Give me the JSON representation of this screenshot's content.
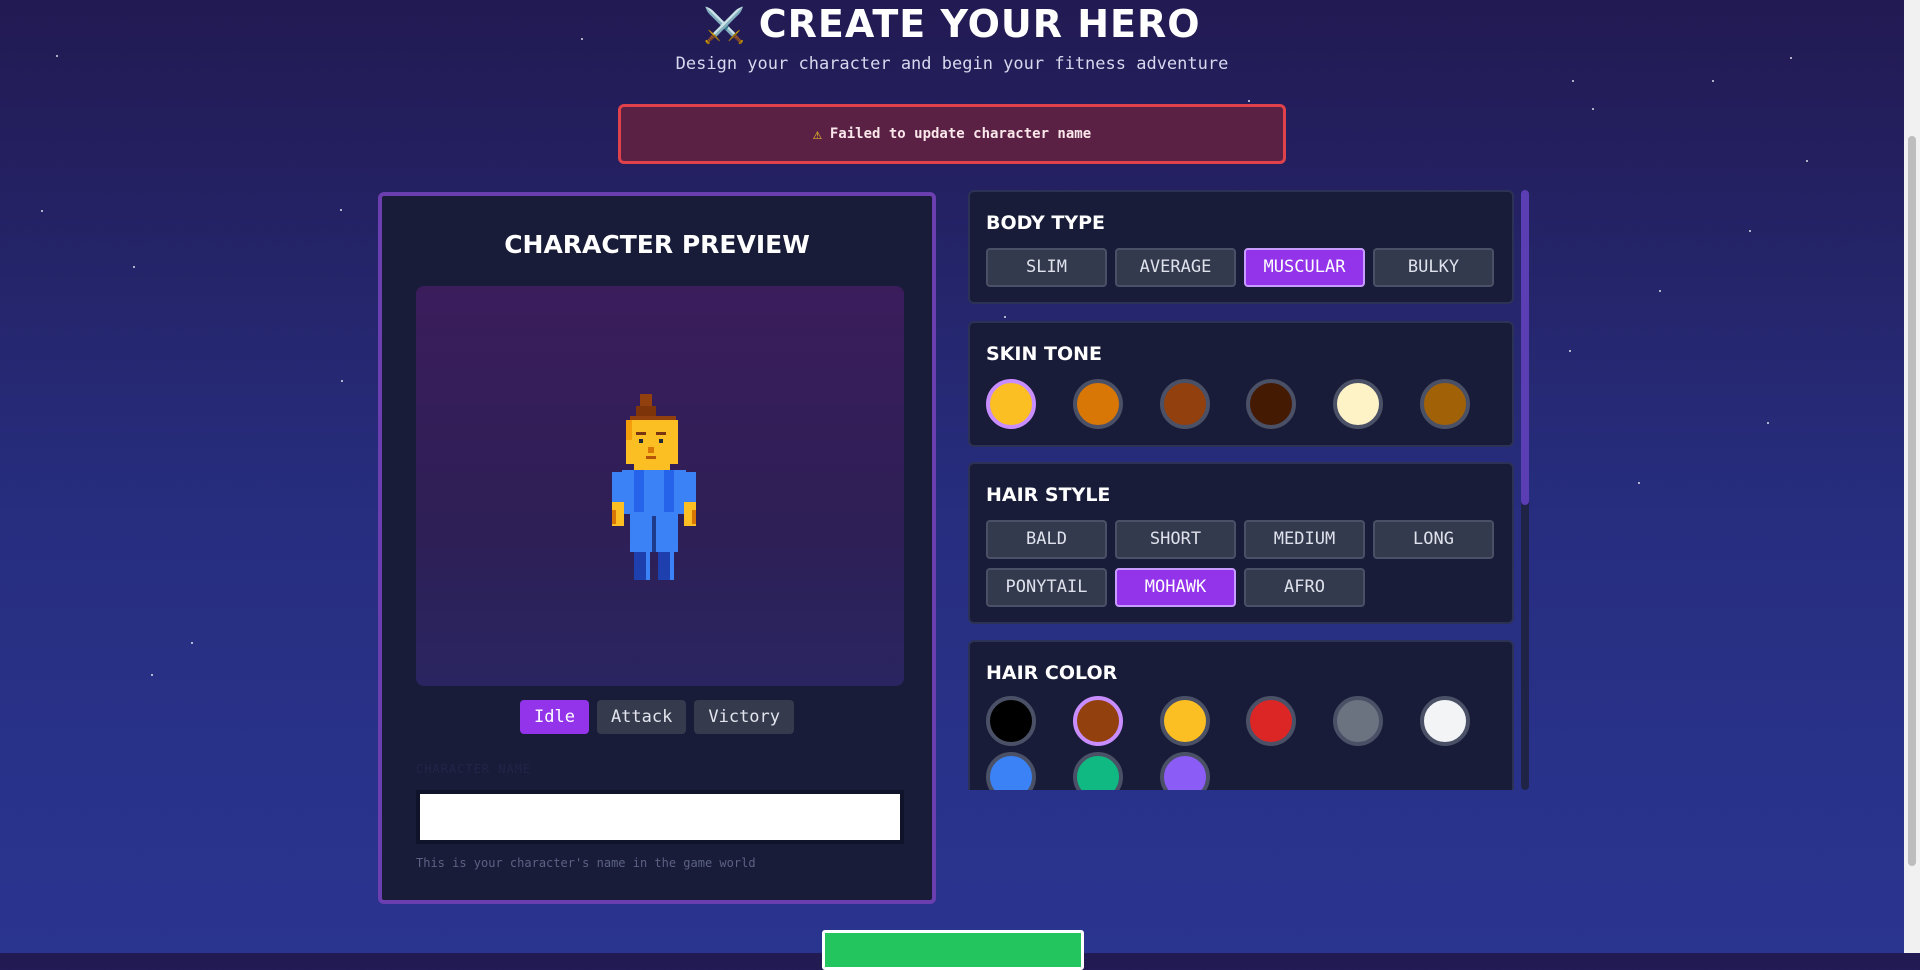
{
  "header": {
    "title": "CREATE YOUR HERO",
    "title_icon": "crossed-swords-icon",
    "subtitle": "Design your character and begin your fitness adventure"
  },
  "alert": {
    "icon": "warning-icon",
    "message": "Failed to update character name",
    "colors": {
      "background": "#5a2145",
      "border": "#e0424b"
    }
  },
  "preview": {
    "title": "CHARACTER PREVIEW",
    "animations": [
      {
        "label": "Idle",
        "selected": true
      },
      {
        "label": "Attack",
        "selected": false
      },
      {
        "label": "Victory",
        "selected": false
      }
    ],
    "name_field": {
      "label": "CHARACTER NAME",
      "value": "",
      "hint": "This is your character's name in the game world"
    }
  },
  "sections": {
    "body_type": {
      "title": "BODY TYPE",
      "options": [
        {
          "label": "SLIM",
          "selected": false
        },
        {
          "label": "AVERAGE",
          "selected": false
        },
        {
          "label": "MUSCULAR",
          "selected": true
        },
        {
          "label": "BULKY",
          "selected": false
        }
      ]
    },
    "skin_tone": {
      "title": "SKIN TONE",
      "swatches": [
        {
          "color": "#fbbf24",
          "selected": true
        },
        {
          "color": "#d97706",
          "selected": false
        },
        {
          "color": "#92400e",
          "selected": false
        },
        {
          "color": "#451a03",
          "selected": false
        },
        {
          "color": "#fef3c7",
          "selected": false
        },
        {
          "color": "#a16207",
          "selected": false
        }
      ]
    },
    "hair_style": {
      "title": "HAIR STYLE",
      "options": [
        {
          "label": "BALD",
          "selected": false
        },
        {
          "label": "SHORT",
          "selected": false
        },
        {
          "label": "MEDIUM",
          "selected": false
        },
        {
          "label": "LONG",
          "selected": false
        },
        {
          "label": "PONYTAIL",
          "selected": false
        },
        {
          "label": "MOHAWK",
          "selected": true
        },
        {
          "label": "AFRO",
          "selected": false
        }
      ]
    },
    "hair_color": {
      "title": "HAIR COLOR",
      "swatches": [
        {
          "color": "#000000",
          "selected": false
        },
        {
          "color": "#92400e",
          "selected": true
        },
        {
          "color": "#fbbf24",
          "selected": false
        },
        {
          "color": "#dc2626",
          "selected": false
        },
        {
          "color": "#6b7280",
          "selected": false
        },
        {
          "color": "#f3f4f6",
          "selected": false
        },
        {
          "color": "#3b82f6",
          "selected": false
        },
        {
          "color": "#10b981",
          "selected": false
        },
        {
          "color": "#8b5cf6",
          "selected": false
        }
      ]
    }
  },
  "colors": {
    "accent": "#9333ea",
    "panel": "#181c38",
    "start_button": "#22c55e"
  }
}
